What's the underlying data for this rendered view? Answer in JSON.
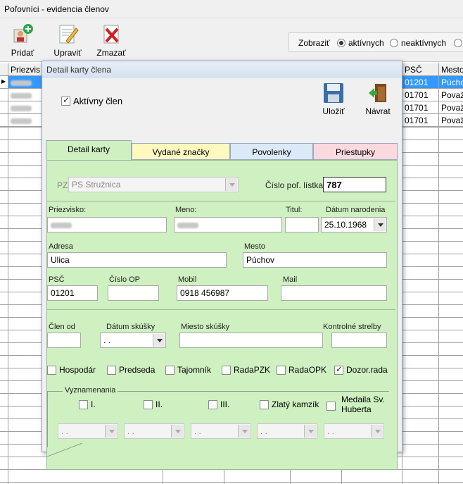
{
  "window": {
    "title": "Poľovníci  - evidencia členov"
  },
  "toolbar": {
    "add": "Pridať",
    "edit": "Upraviť",
    "delete": "Zmazať"
  },
  "filter": {
    "label": "Zobraziť",
    "opt_active": "aktívnych",
    "opt_inactive": "neaktívnych"
  },
  "grid": {
    "headers": {
      "surname": "Priezvis",
      "psc": "PSČ",
      "city": "Mesto"
    },
    "rows": [
      {
        "psc": "01201",
        "city": "Púchov"
      },
      {
        "psc": "01701",
        "city": "Považ"
      },
      {
        "psc": "01701",
        "city": "Považ"
      },
      {
        "psc": "01701",
        "city": "Považ"
      }
    ]
  },
  "dialog": {
    "title": "Detail karty člena",
    "active_label": "Aktívny člen",
    "active_checked": true,
    "save_label": "Uložiť",
    "back_label": "Návrat",
    "tabs": [
      "Detail karty",
      "Vydané značky",
      "Povolenky",
      "Priestupky"
    ],
    "tab_colors": [
      "#cff0c1",
      "#fff9bf",
      "#dce9f9",
      "#fbd9df"
    ],
    "form": {
      "pz_label": "PZ:",
      "pz_value": "PS Stružnica",
      "ticket_label": "Číslo poľ. lístka:",
      "ticket_value": "787",
      "surname_label": "Priezvisko:",
      "name_label": "Meno:",
      "title_label": "Titul:",
      "birth_label": "Dátum narodenia",
      "birth_value": "25.10.1968",
      "address_label": "Adresa",
      "address_value": "Ulica",
      "city_label": "Mesto",
      "city_value": "Púchov",
      "psc_label": "PSČ",
      "psc_value": "01201",
      "op_label": "Číslo OP",
      "mobile_label": "Mobil",
      "mobile_value": "0918 456987",
      "mail_label": "Mail",
      "member_from_label": "Člen od",
      "exam_date_label": "Dátum skúšky",
      "exam_date_value": " . .",
      "exam_place_label": "Miesto skúšky",
      "control_label": "Kontrolné strelby",
      "roles": [
        {
          "label": "Hospodár",
          "checked": false
        },
        {
          "label": "Predseda",
          "checked": false
        },
        {
          "label": "Tajomník",
          "checked": false
        },
        {
          "label": "RadaPZK",
          "checked": false
        },
        {
          "label": "RadaOPK",
          "checked": false
        },
        {
          "label": "Dozor.rada",
          "checked": true
        }
      ],
      "awards_label": "Vyznamenania",
      "awards": [
        "I.",
        "II.",
        "III.",
        "Zlatý kamzík",
        "Medaila Sv. Huberta"
      ],
      "award_date_placeholder": " . ."
    }
  }
}
